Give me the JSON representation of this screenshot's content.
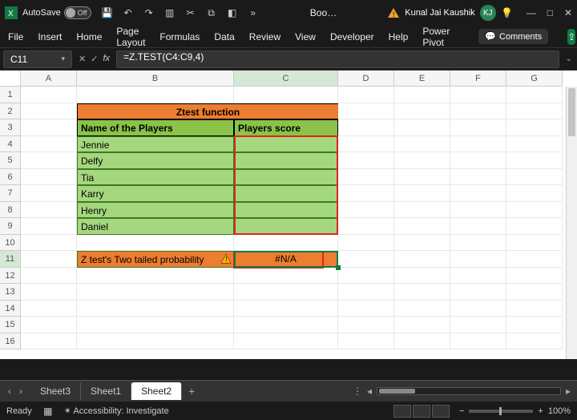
{
  "titlebar": {
    "autosave_label": "AutoSave",
    "autosave_state": "Off",
    "doc_name": "Boo…",
    "user_name": "Kunal Jai Kaushik",
    "user_initials": "KJ"
  },
  "ribbon": {
    "tabs": [
      "File",
      "Insert",
      "Home",
      "Page Layout",
      "Formulas",
      "Data",
      "Review",
      "View",
      "Developer",
      "Help",
      "Power Pivot"
    ],
    "comments": "Comments"
  },
  "formula": {
    "namebox": "C11",
    "formula_text": "=Z.TEST(C4:C9,4)"
  },
  "columns": [
    "A",
    "B",
    "C",
    "D",
    "E",
    "F",
    "G"
  ],
  "row_count": 16,
  "sheet": {
    "title_merged": "Ztest function",
    "header_b": "Name of the Players",
    "header_c": "Players score",
    "players": [
      "Jennie",
      "Delfy",
      "Tia",
      "Karry",
      "Henry",
      "Daniel"
    ],
    "b11_text": "Z test's Two tailed probability",
    "c11_value": "#N/A"
  },
  "tabs": {
    "items": [
      "Sheet3",
      "Sheet1",
      "Sheet2"
    ],
    "active": "Sheet2"
  },
  "status": {
    "ready": "Ready",
    "access": "Accessibility: Investigate",
    "zoom": "100%"
  }
}
